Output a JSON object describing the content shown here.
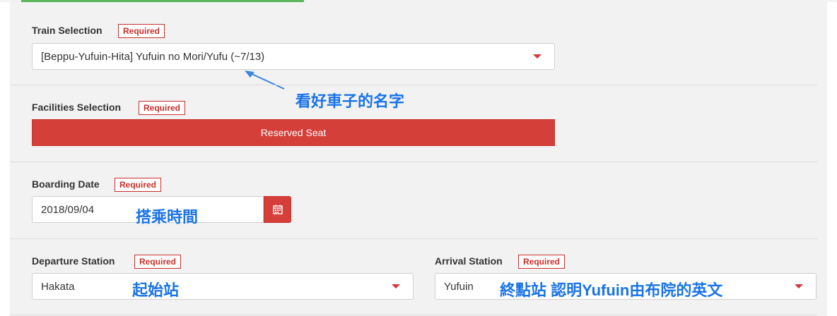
{
  "form": {
    "train_selection": {
      "label": "Train Selection",
      "required": "Required",
      "value": "[Beppu-Yufuin-Hita] Yufuin no Mori/Yufu (~7/13)"
    },
    "facilities_selection": {
      "label": "Facilities Selection",
      "required": "Required",
      "button_label": "Reserved Seat"
    },
    "boarding_date": {
      "label": "Boarding Date",
      "required": "Required",
      "value": "2018/09/04"
    },
    "departure_station": {
      "label": "Departure Station",
      "required": "Required",
      "value": "Hakata"
    },
    "arrival_station": {
      "label": "Arrival Station",
      "required": "Required",
      "value": "Yufuin"
    }
  },
  "annotations": {
    "train_note": "看好車子的名字",
    "date_note": "搭乘時間",
    "departure_note": "起始站",
    "arrival_note": "終點站 認明Yufuin由布院的英文"
  },
  "colors": {
    "accent_red": "#d43f3a",
    "annotation_blue": "#1a73e8",
    "progress_green": "#5cb85c"
  },
  "icons": {
    "calendar": "calendar-icon",
    "dropdown": "caret-down-icon"
  }
}
